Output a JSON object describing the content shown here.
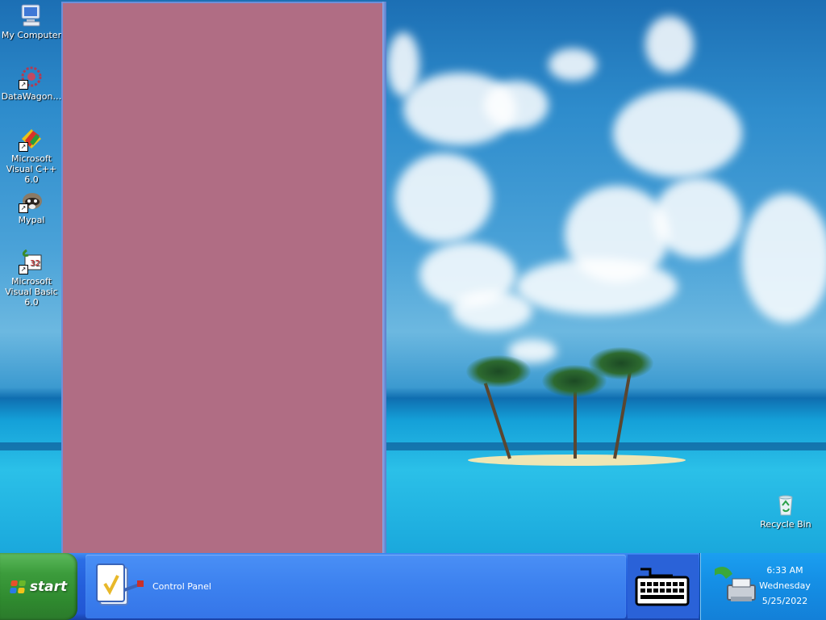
{
  "desktop": {
    "icons": [
      {
        "label": "My Computer",
        "icon": "computer-icon",
        "shortcut": false
      },
      {
        "label": "DataWagon…",
        "icon": "datawagon-icon",
        "shortcut": true
      },
      {
        "label": "Microsoft Visual C++ 6.0",
        "icon": "visual-cpp-icon",
        "shortcut": true
      },
      {
        "label": "Mypal",
        "icon": "mypal-raccoon-icon",
        "shortcut": true
      },
      {
        "label": "Microsoft Visual Basic 6.0",
        "icon": "visual-basic-icon",
        "shortcut": true
      }
    ],
    "recycle_bin": {
      "label": "Recycle Bin",
      "icon": "recycle-bin-icon"
    }
  },
  "window": {
    "color": "#b06d84"
  },
  "taskbar": {
    "start_label": "start",
    "tasks": [
      {
        "label": "Control Panel",
        "icon": "control-panel-icon"
      }
    ],
    "quick_icon": "keyboard-icon",
    "tray_icon": "network-printer-icon",
    "clock": {
      "time": "6:33 AM",
      "day": "Wednesday",
      "date": "5/25/2022"
    }
  },
  "colors": {
    "start_green": "#3c9c3c",
    "taskbar_blue": "#245edb",
    "tray_blue": "#1590e6"
  }
}
